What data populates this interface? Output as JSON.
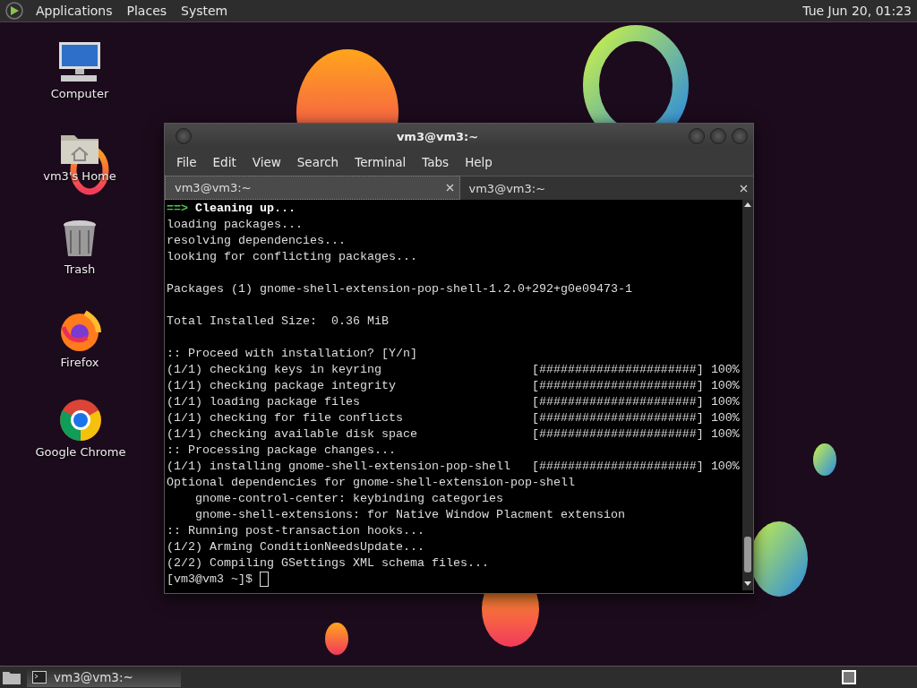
{
  "top_panel": {
    "menus": [
      "Applications",
      "Places",
      "System"
    ],
    "clock": "Tue Jun 20, 01:23"
  },
  "desktop_icons": [
    {
      "kind": "computer",
      "label": "Computer"
    },
    {
      "kind": "home",
      "label": "vm3's Home"
    },
    {
      "kind": "trash",
      "label": "Trash"
    },
    {
      "kind": "firefox",
      "label": "Firefox"
    },
    {
      "kind": "chrome",
      "label": "Google Chrome"
    }
  ],
  "window": {
    "title": "vm3@vm3:~",
    "menu": [
      "File",
      "Edit",
      "View",
      "Search",
      "Terminal",
      "Tabs",
      "Help"
    ],
    "tabs": [
      {
        "label": "vm3@vm3:~",
        "selected": true
      },
      {
        "label": "vm3@vm3:~",
        "selected": false
      }
    ],
    "lines": [
      {
        "kind": "heading",
        "arrow": "==>",
        "text": "Cleaning up..."
      },
      {
        "kind": "text",
        "text": "loading packages..."
      },
      {
        "kind": "text",
        "text": "resolving dependencies..."
      },
      {
        "kind": "text",
        "text": "looking for conflicting packages..."
      },
      {
        "kind": "blank"
      },
      {
        "kind": "text",
        "text": "Packages (1) gnome-shell-extension-pop-shell-1.2.0+292+g0e09473-1"
      },
      {
        "kind": "blank"
      },
      {
        "kind": "text",
        "text": "Total Installed Size:  0.36 MiB"
      },
      {
        "kind": "blank"
      },
      {
        "kind": "text",
        "text": ":: Proceed with installation? [Y/n]"
      },
      {
        "kind": "progress",
        "text": "(1/1) checking keys in keyring",
        "bar": "[######################]",
        "percent": "100%"
      },
      {
        "kind": "progress",
        "text": "(1/1) checking package integrity",
        "bar": "[######################]",
        "percent": "100%"
      },
      {
        "kind": "progress",
        "text": "(1/1) loading package files",
        "bar": "[######################]",
        "percent": "100%"
      },
      {
        "kind": "progress",
        "text": "(1/1) checking for file conflicts",
        "bar": "[######################]",
        "percent": "100%"
      },
      {
        "kind": "progress",
        "text": "(1/1) checking available disk space",
        "bar": "[######################]",
        "percent": "100%"
      },
      {
        "kind": "text",
        "text": ":: Processing package changes..."
      },
      {
        "kind": "progress",
        "text": "(1/1) installing gnome-shell-extension-pop-shell",
        "bar": "[######################]",
        "percent": "100%"
      },
      {
        "kind": "text",
        "text": "Optional dependencies for gnome-shell-extension-pop-shell"
      },
      {
        "kind": "text",
        "text": "    gnome-control-center: keybinding categories"
      },
      {
        "kind": "text",
        "text": "    gnome-shell-extensions: for Native Window Placment extension"
      },
      {
        "kind": "text",
        "text": ":: Running post-transaction hooks..."
      },
      {
        "kind": "text",
        "text": "(1/2) Arming ConditionNeedsUpdate..."
      },
      {
        "kind": "text",
        "text": "(2/2) Compiling GSettings XML schema files..."
      },
      {
        "kind": "prompt",
        "text": "[vm3@vm3 ~]$ "
      }
    ]
  },
  "taskbar": {
    "tasks": [
      {
        "label": "vm3@vm3:~",
        "selected": true
      }
    ]
  }
}
